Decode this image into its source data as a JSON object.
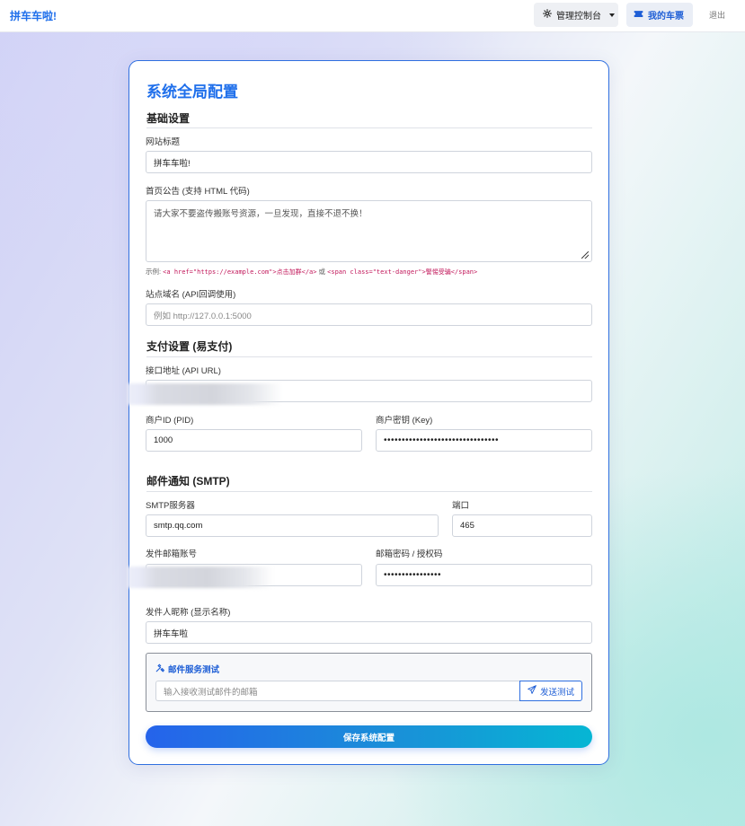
{
  "navbar": {
    "brand": "拼车车啦!",
    "admin_label": "管理控制台",
    "admin_icon": "gear-icon",
    "tickets_label": "我的车票",
    "tickets_icon": "ticket-icon",
    "logout_label": "退出"
  },
  "page": {
    "title": "系统全局配置"
  },
  "basic": {
    "section_title": "基础设置",
    "site_title_label": "网站标题",
    "site_title_value": "拼车车啦!",
    "announcement_label": "首页公告 (支持 HTML 代码)",
    "announcement_value": "请大家不要盗传搬账号资源，一旦发现，直接不退不换！",
    "example_prefix": "示例: ",
    "example_code1": "<a href=\"https://example.com\">点击加群</a>",
    "example_or": " 或 ",
    "example_code2": "<span class=\"text-danger\">警惕受骗</span>",
    "domain_label": "站点域名 (API回调使用)",
    "domain_placeholder": "例如 http://127.0.0.1:5000"
  },
  "payment": {
    "section_title": "支付设置 (易支付)",
    "api_url_label": "接口地址 (API URL)",
    "pid_label": "商户ID (PID)",
    "pid_value": "1000",
    "key_label": "商户密钥 (Key)",
    "key_value": "••••••••••••••••••••••••••••••••"
  },
  "mail": {
    "section_title": "邮件通知 (SMTP)",
    "server_label": "SMTP服务器",
    "server_value": "smtp.qq.com",
    "port_label": "端口",
    "port_value": "465",
    "account_label": "发件邮箱账号",
    "password_label": "邮箱密码 / 授权码",
    "password_value": "••••••••••••••••",
    "sender_label": "发件人昵称 (显示名称)",
    "sender_value": "拼车车啦"
  },
  "test": {
    "title": "邮件服务测试",
    "title_icon": "tools-icon",
    "input_placeholder": "输入接收测试邮件的邮箱",
    "send_label": "发送测试",
    "send_icon": "send-icon"
  },
  "save_label": "保存系统配置",
  "colors": {
    "accent": "#1f6feb",
    "border_active": "#2f6fe0",
    "code": "#c2185b"
  }
}
